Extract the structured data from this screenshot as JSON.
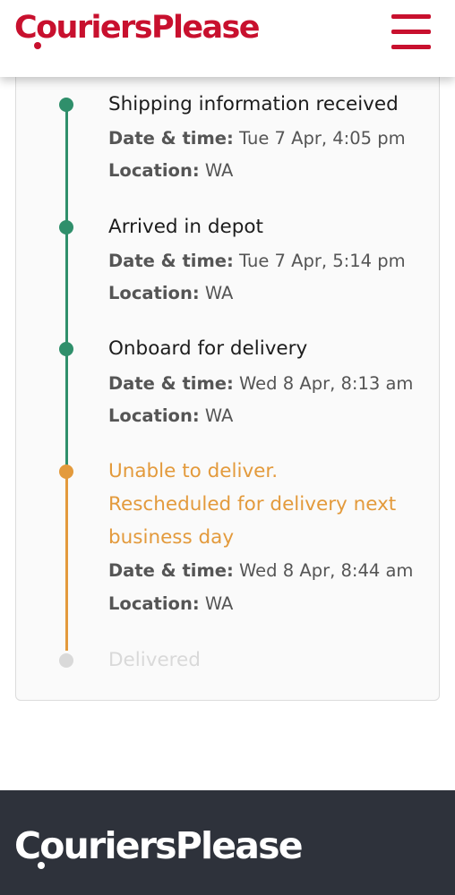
{
  "colors": {
    "brand": "#c8102e",
    "done": "#2f8f6b",
    "warning": "#e39a3c",
    "future": "#d9d9d9",
    "footer_bg": "#2e323b"
  },
  "header": {
    "logo_part1": "Couriers",
    "logo_part2": "Please",
    "menu_icon": "hamburger-menu-icon"
  },
  "timeline": {
    "events": [
      {
        "title": "Shipping information received",
        "datetime_label": "Date & time:",
        "datetime": "Tue 7 Apr, 4:05 pm",
        "location_label": "Location:",
        "location": "WA",
        "status": "done"
      },
      {
        "title": "Arrived in depot",
        "datetime_label": "Date & time:",
        "datetime": "Tue 7 Apr, 5:14 pm",
        "location_label": "Location:",
        "location": "WA",
        "status": "done"
      },
      {
        "title": "Onboard for delivery",
        "datetime_label": "Date & time:",
        "datetime": "Wed 8 Apr, 8:13 am",
        "location_label": "Location:",
        "location": "WA",
        "status": "done"
      },
      {
        "title_lines": [
          "Unable to deliver.",
          "Rescheduled for delivery next",
          "business day"
        ],
        "datetime_label": "Date & time:",
        "datetime": "Wed 8 Apr, 8:44 am",
        "location_label": "Location:",
        "location": "WA",
        "status": "warning"
      },
      {
        "title": "Delivered",
        "status": "future"
      }
    ]
  },
  "footer": {
    "logo_part1": "Couriers",
    "logo_part2": "Please"
  }
}
